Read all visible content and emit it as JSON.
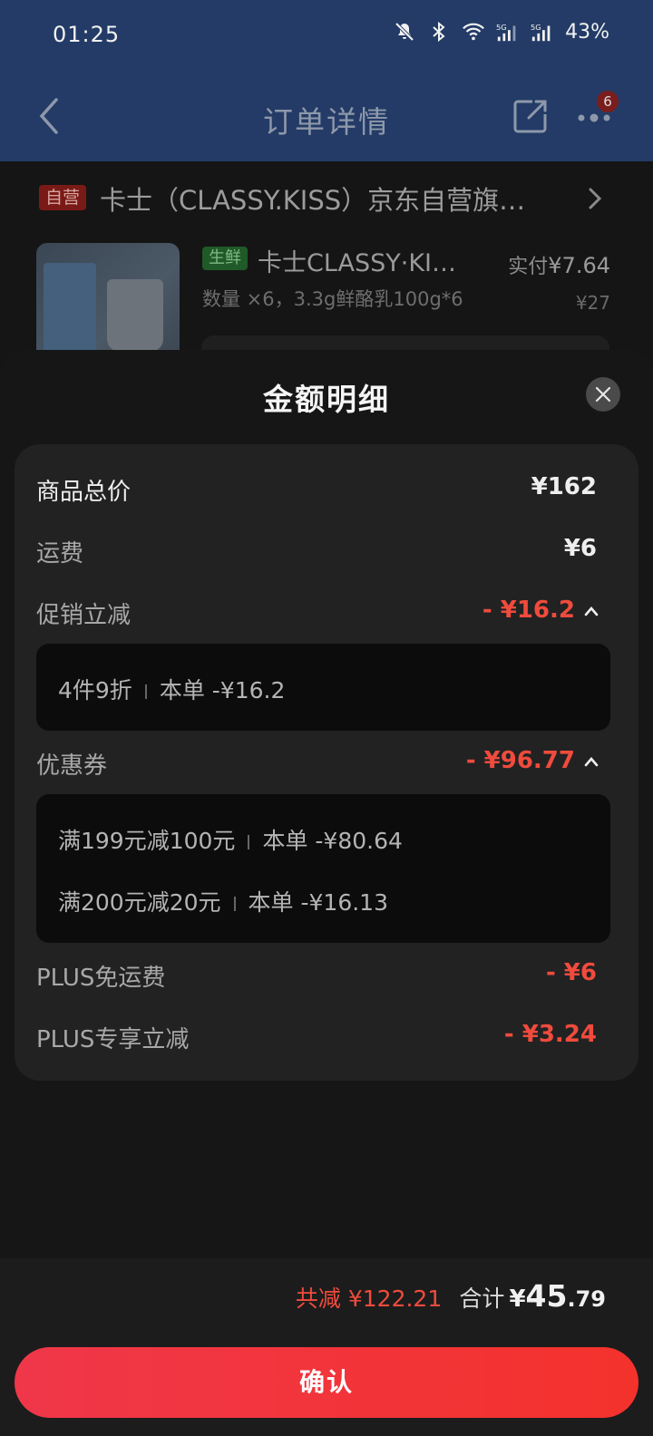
{
  "status_bar": {
    "time": "01:25",
    "battery": "43%",
    "icons": [
      "mute-icon",
      "bluetooth-icon",
      "wifi-icon",
      "signal-5g-icon",
      "signal-5g-icon",
      "battery-text"
    ]
  },
  "header": {
    "title": "订单详情",
    "more_badge": "6"
  },
  "shop": {
    "tag": "自营",
    "name": "卡士（CLASSY.KISS）京东自营旗…"
  },
  "product": {
    "tag": "生鲜",
    "name": "卡士CLASSY·KI…",
    "paid_label": "实付",
    "paid_price": "¥7.64",
    "qty_spec": "数量 ×6，3.3g鲜酪乳100g*6",
    "orig_price": "¥27"
  },
  "sheet": {
    "title": "金额明细",
    "rows": {
      "goods_total": {
        "label": "商品总价",
        "value": "¥162"
      },
      "shipping": {
        "label": "运费",
        "value": "¥6"
      },
      "promo": {
        "label": "促销立减",
        "value": "- ¥16.2"
      },
      "coupon": {
        "label": "优惠券",
        "value": "- ¥96.77"
      },
      "plus_shipping": {
        "label": "PLUS免运费",
        "value": "- ¥6"
      },
      "plus_discount": {
        "label": "PLUS专享立减",
        "value": "- ¥3.24"
      }
    },
    "promo_details": [
      {
        "name": "4件9折",
        "scope": "本单",
        "amount": "-¥16.2"
      }
    ],
    "coupon_details": [
      {
        "name": "满199元减100元",
        "scope": "本单",
        "amount": "-¥80.64"
      },
      {
        "name": "满200元减20元",
        "scope": "本单",
        "amount": "-¥16.13"
      }
    ]
  },
  "footer": {
    "saved": "共减 ¥122.21",
    "total_label": "合计",
    "total_yen": "¥",
    "total_int": "45",
    "total_dec": ".79",
    "confirm": "确认"
  },
  "colors": {
    "header_bg": "#233b66",
    "accent_red": "#f04b3d",
    "button_start": "#f0374a",
    "button_end": "#f4322c"
  }
}
